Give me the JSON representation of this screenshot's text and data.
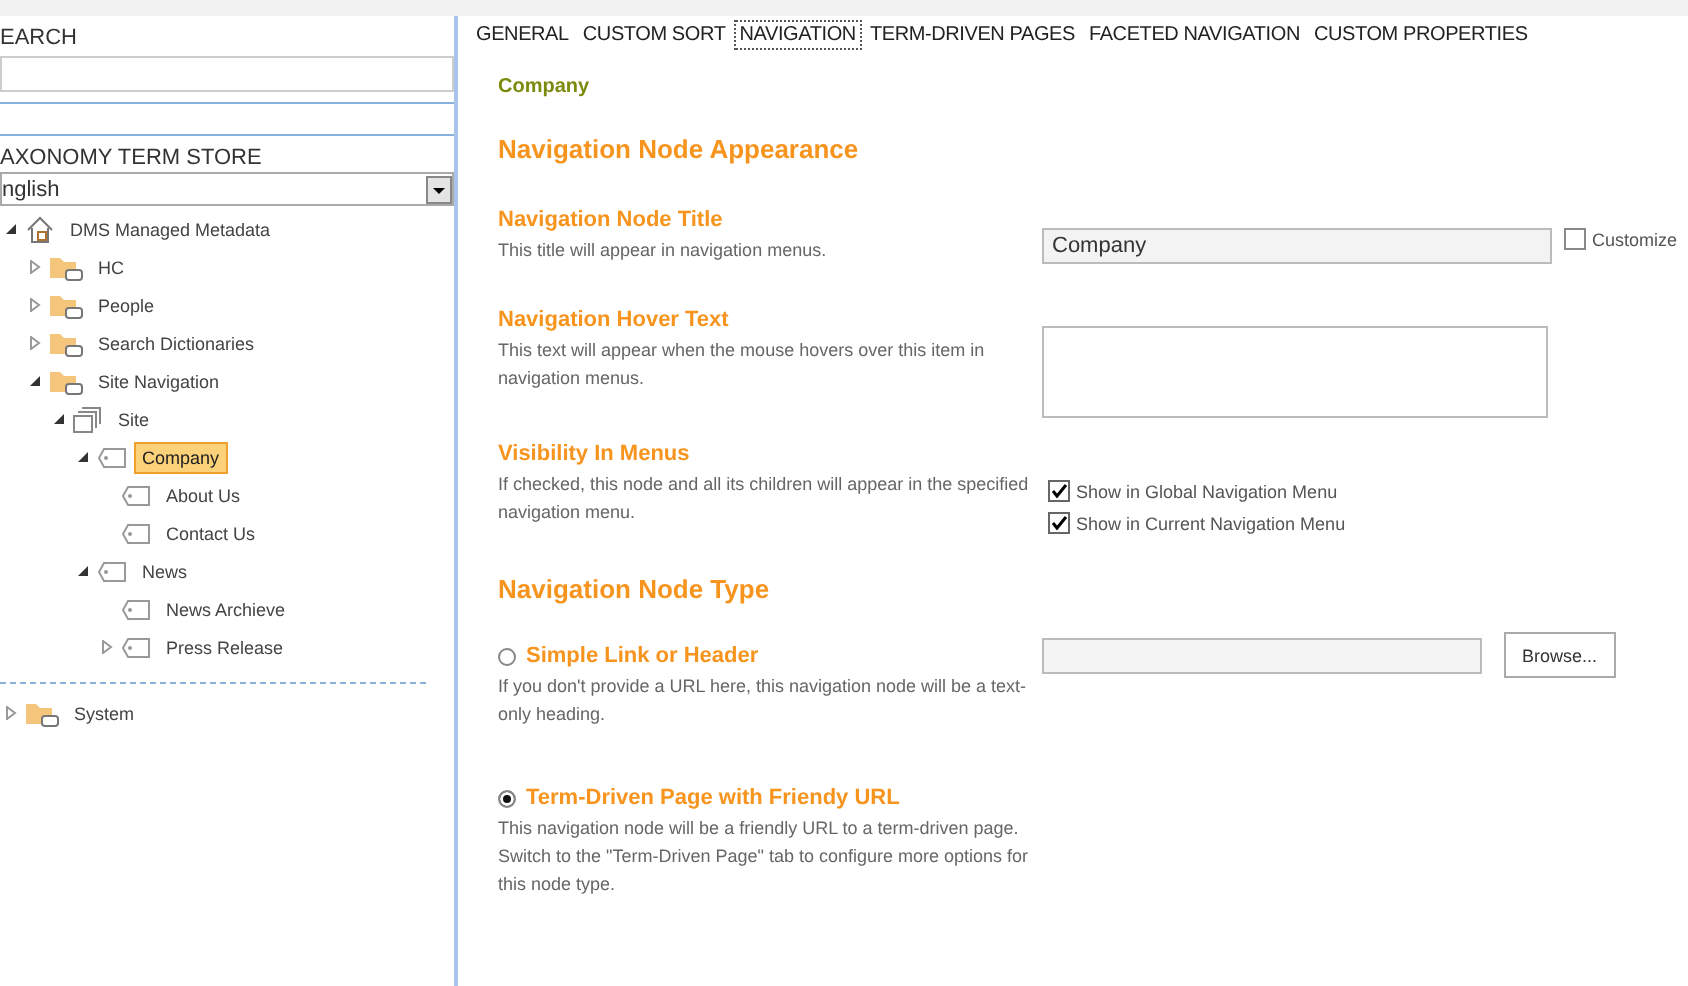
{
  "left_panel": {
    "search_label": "EARCH",
    "term_store_label": "AXONOMY TERM STORE",
    "language": "nglish",
    "tree": [
      {
        "label": "DMS Managed Metadata",
        "kind": "home",
        "expanded": true,
        "selected": false,
        "children": [
          {
            "label": "HC",
            "kind": "folder",
            "expanded": false,
            "selected": false
          },
          {
            "label": "People",
            "kind": "folder",
            "expanded": false,
            "selected": false
          },
          {
            "label": "Search Dictionaries",
            "kind": "folder",
            "expanded": false,
            "selected": false
          },
          {
            "label": "Site Navigation",
            "kind": "folder",
            "expanded": true,
            "selected": false,
            "children": [
              {
                "label": "Site",
                "kind": "site",
                "expanded": true,
                "selected": false,
                "children": [
                  {
                    "label": "Company",
                    "kind": "term",
                    "expanded": true,
                    "selected": true,
                    "children": [
                      {
                        "label": "About Us",
                        "kind": "term",
                        "selected": false
                      },
                      {
                        "label": "Contact Us",
                        "kind": "term",
                        "selected": false
                      }
                    ]
                  },
                  {
                    "label": "News",
                    "kind": "term",
                    "expanded": true,
                    "selected": false,
                    "children": [
                      {
                        "label": "News Archieve",
                        "kind": "term",
                        "selected": false
                      },
                      {
                        "label": "Press Release",
                        "kind": "term",
                        "expanded": false,
                        "selected": false
                      }
                    ]
                  }
                ]
              }
            ]
          }
        ]
      }
    ],
    "system_tree": [
      {
        "label": "System",
        "kind": "folder",
        "expanded": false,
        "selected": false
      }
    ]
  },
  "tabs": [
    {
      "label": "GENERAL",
      "selected": false
    },
    {
      "label": "CUSTOM SORT",
      "selected": false
    },
    {
      "label": "NAVIGATION",
      "selected": true
    },
    {
      "label": "TERM-DRIVEN PAGES",
      "selected": false
    },
    {
      "label": "FACETED NAVIGATION",
      "selected": false
    },
    {
      "label": "CUSTOM PROPERTIES",
      "selected": false
    }
  ],
  "term_name": "Company",
  "appearance_heading": "Navigation Node Appearance",
  "title_field": {
    "label": "Navigation Node Title",
    "description": "This title will appear in navigation menus.",
    "value": "Company",
    "customize": {
      "label": "Customize",
      "checked": false
    }
  },
  "hover_field": {
    "label": "Navigation Hover Text",
    "description": "This text will appear when the mouse hovers over this item in navigation menus."
  },
  "visibility": {
    "label": "Visibility In Menus",
    "description": "If checked, this node and all its children will appear in the specified navigation menu.",
    "options": [
      {
        "label": "Show in Global Navigation Menu",
        "checked": true
      },
      {
        "label": "Show in Current Navigation Menu",
        "checked": true
      }
    ]
  },
  "type_heading": "Navigation Node Type",
  "node_types": [
    {
      "kind": "link",
      "label": "Simple Link or Header",
      "description": "If you don't provide a URL here, this navigation node will be a text-only heading.",
      "selected": false,
      "button": "Browse..."
    },
    {
      "kind": "term",
      "label": "Term-Driven Page with Friendy URL",
      "description": "This navigation node will be a friendly URL to a term-driven page. Switch to the \"Term-Driven Page\" tab to configure more options for this node type.",
      "selected": true
    }
  ]
}
